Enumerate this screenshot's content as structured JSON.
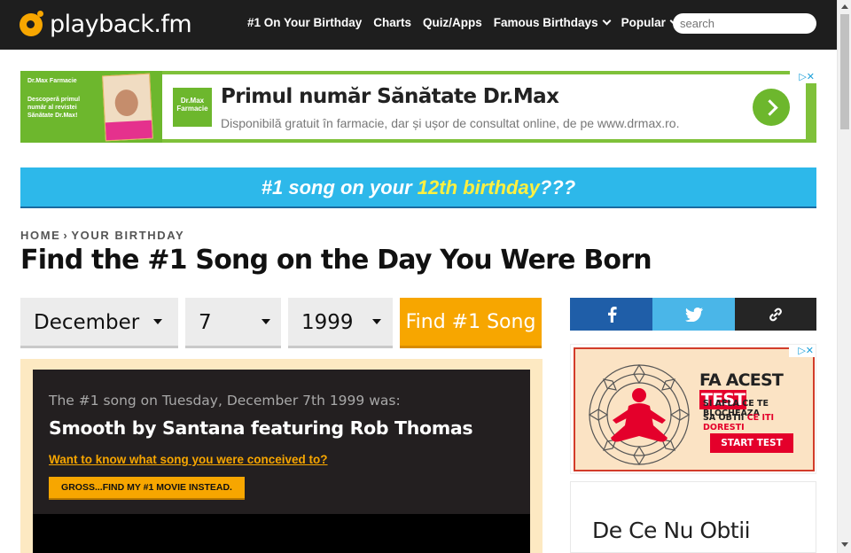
{
  "header": {
    "logo_text": "playback.fm",
    "nav": [
      {
        "label": "#1 On Your Birthday",
        "dropdown": false
      },
      {
        "label": "Charts",
        "dropdown": false
      },
      {
        "label": "Quiz/Apps",
        "dropdown": false
      },
      {
        "label": "Famous Birthdays",
        "dropdown": true
      },
      {
        "label": "Popular",
        "dropdown": true
      }
    ],
    "search_placeholder": "search"
  },
  "ad_top": {
    "brand": "Dr.Max",
    "brand_sub": "Farmacie",
    "left_text": "Descoperă primul număr al revistei Sănătate Dr.Max!",
    "title": "Primul număr Sănătate Dr.Max",
    "description": "Disponibilă gratuit în farmacie, dar și ușor de consultat online, de pe www.drmax.ro.",
    "choices_icons": "▷✕"
  },
  "banner": {
    "prefix": "#1 song on your ",
    "highlight": "12th birthday",
    "suffix": "???"
  },
  "breadcrumb": {
    "home": "HOME",
    "sep": "›",
    "current": "YOUR BIRTHDAY"
  },
  "page_title": "Find the #1 Song on the Day You Were Born",
  "form": {
    "month": "December",
    "day": "7",
    "year": "1999",
    "submit_label": "Find #1 Song"
  },
  "result": {
    "intro": "The #1 song on Tuesday, December 7th 1999 was:",
    "song": "Smooth by Santana featuring Rob Thomas",
    "link": "Want to know what song you were conceived to?",
    "movie_button": "GROSS...FIND MY #1 MOVIE INSTEAD."
  },
  "share": {
    "icons": [
      "facebook-icon",
      "twitter-icon",
      "link-icon"
    ],
    "colors": {
      "facebook": "#1f5ea8",
      "twitter": "#4ab6e8",
      "link": "#252525"
    }
  },
  "ad_side": {
    "heading_a": "FA ACEST ",
    "heading_b": "TEST",
    "line1": "SI AFLA CE TE BLOCHEAZA",
    "line2_a": "SA OBTII ",
    "line2_b": "CE ITI DORESTI",
    "button": "START TEST",
    "choices_icons": "▷✕"
  },
  "side_card": {
    "title": "De Ce Nu Obtii"
  },
  "colors": {
    "accent": "#f7a600",
    "header_bg": "#1e1e1e",
    "banner": "#2db8ea",
    "banner_highlight": "#fff040"
  }
}
